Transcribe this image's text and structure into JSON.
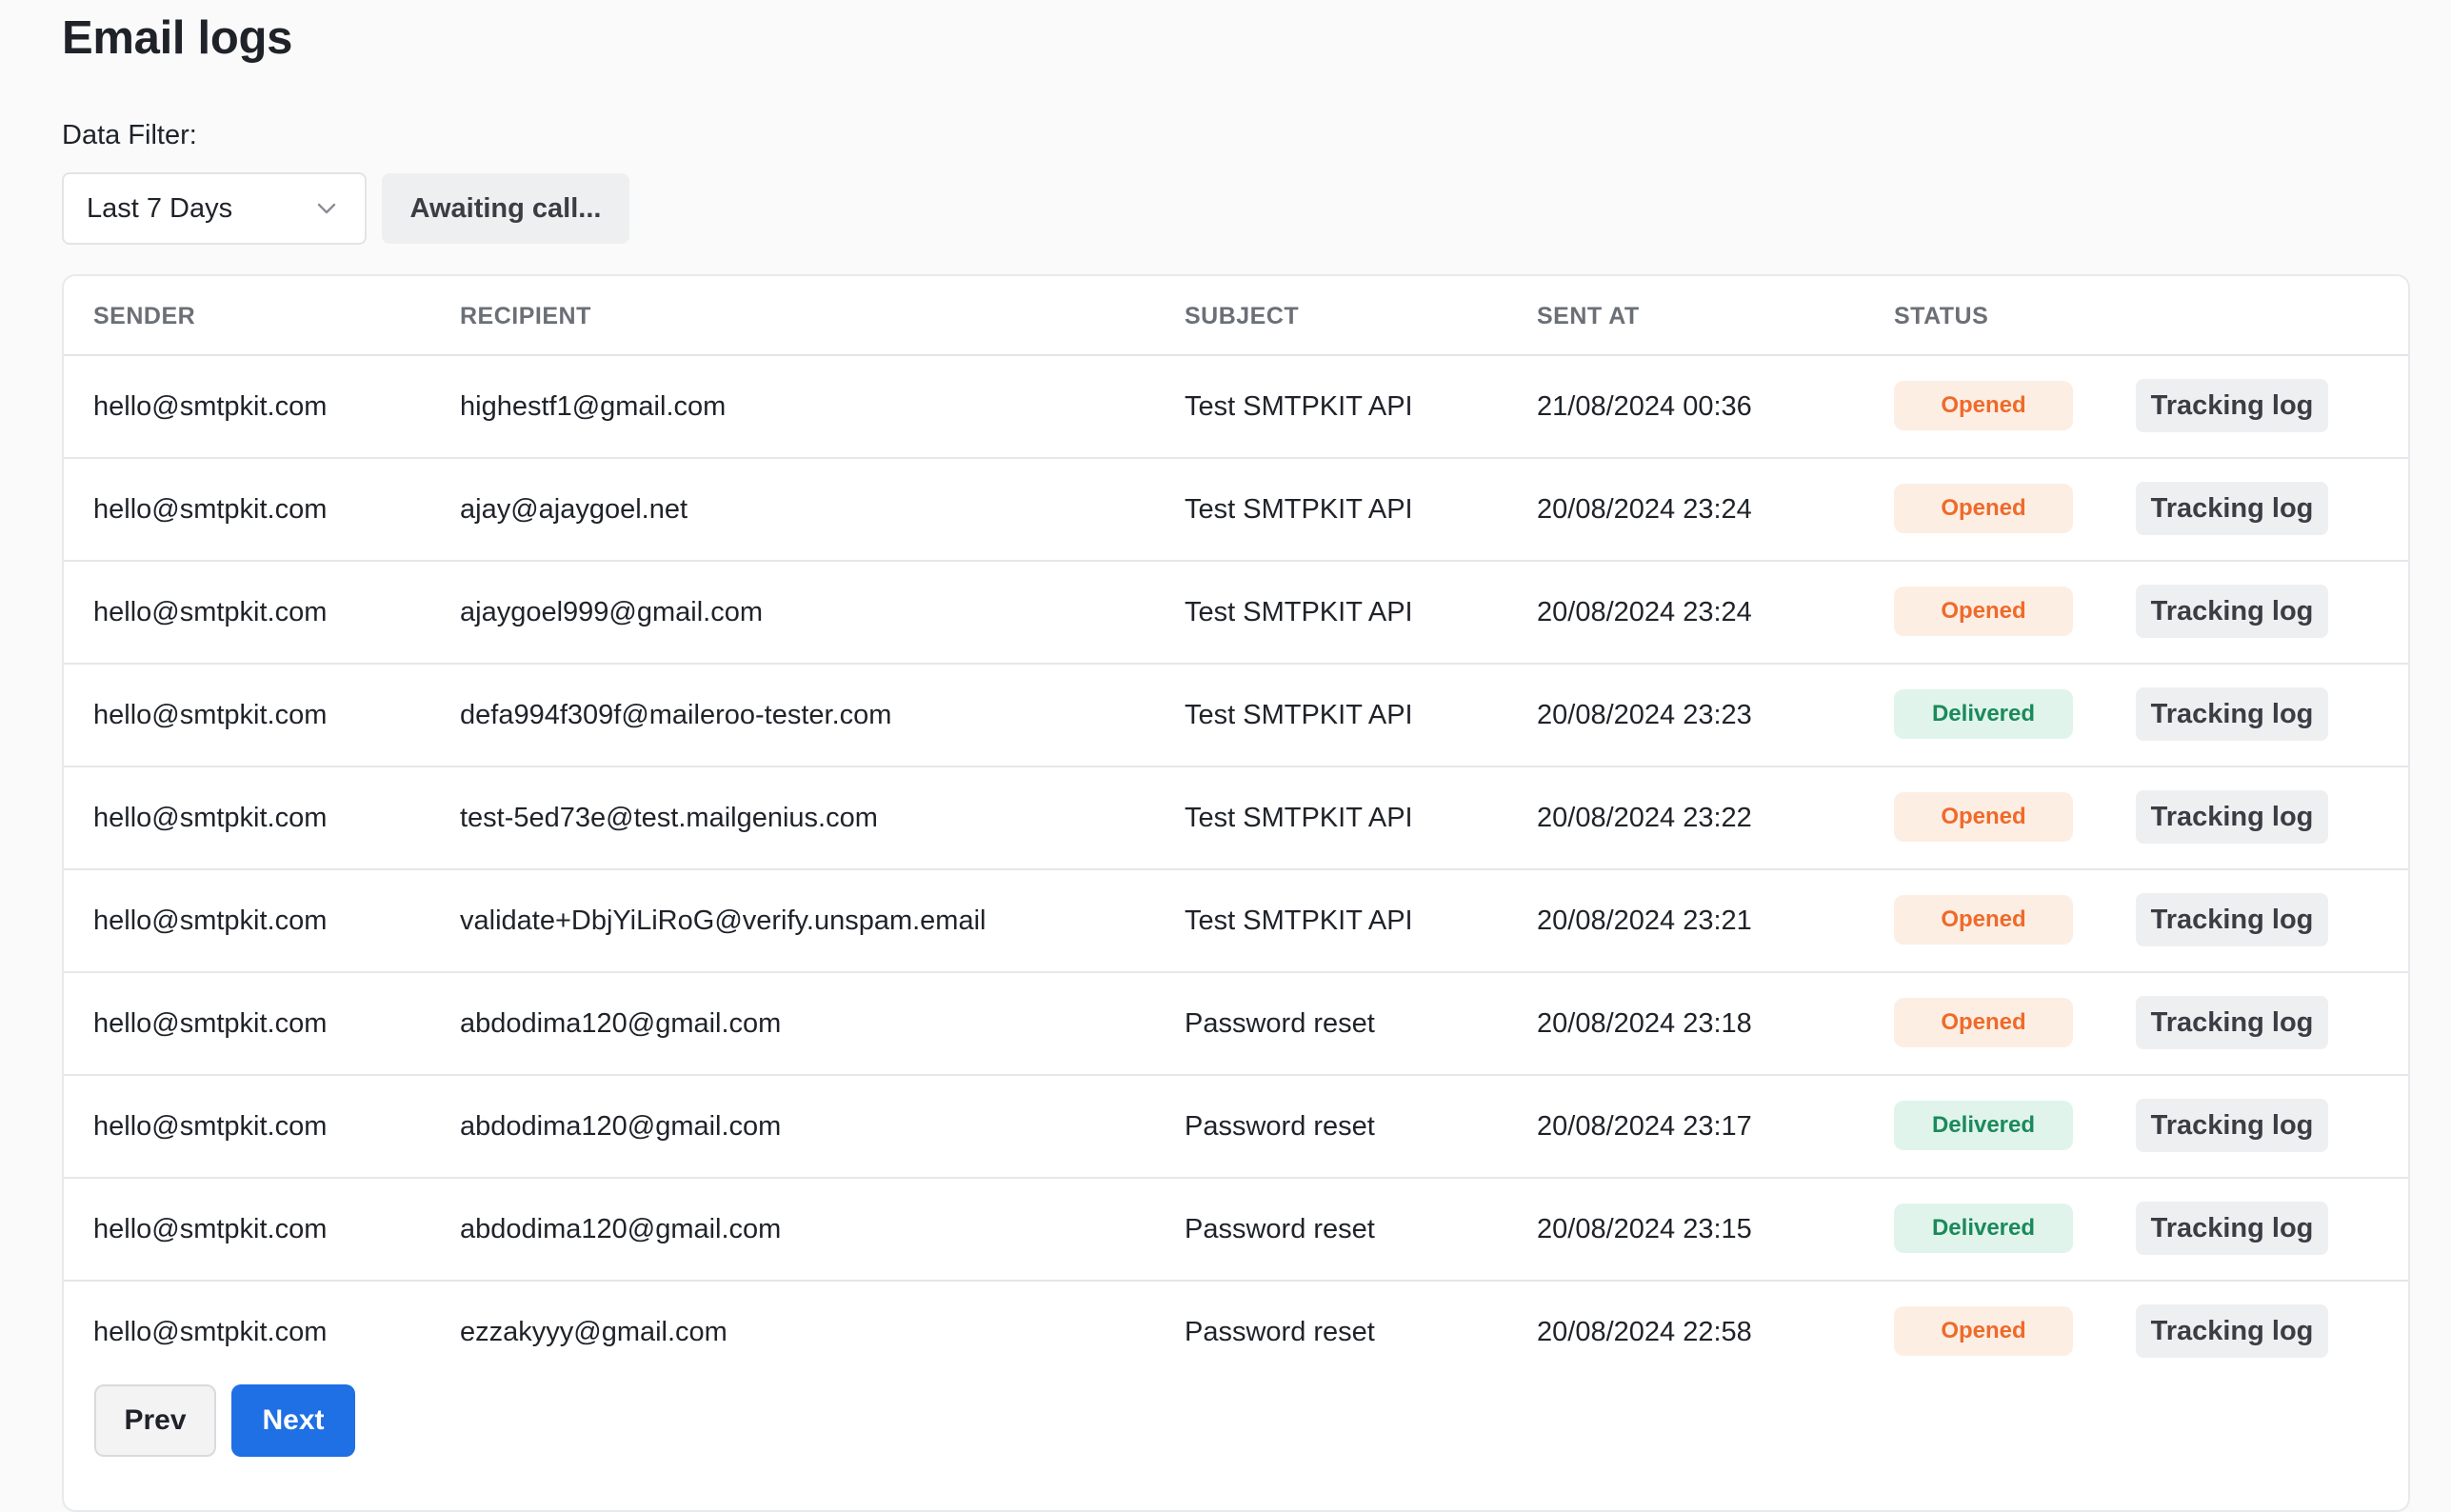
{
  "page": {
    "title": "Email logs"
  },
  "filter": {
    "label": "Data Filter:",
    "selected": "Last 7 Days",
    "awaiting_label": "Awaiting call..."
  },
  "table": {
    "headers": {
      "sender": "SENDER",
      "recipient": "RECIPIENT",
      "subject": "SUBJECT",
      "sent_at": "SENT AT",
      "status": "STATUS"
    },
    "action_label": "Tracking log",
    "rows": [
      {
        "sender": "hello@smtpkit.com",
        "recipient": "highestf1@gmail.com",
        "subject": "Test SMTPKIT API",
        "sent_at": "21/08/2024 00:36",
        "status": "Opened"
      },
      {
        "sender": "hello@smtpkit.com",
        "recipient": "ajay@ajaygoel.net",
        "subject": "Test SMTPKIT API",
        "sent_at": "20/08/2024 23:24",
        "status": "Opened"
      },
      {
        "sender": "hello@smtpkit.com",
        "recipient": "ajaygoel999@gmail.com",
        "subject": "Test SMTPKIT API",
        "sent_at": "20/08/2024 23:24",
        "status": "Opened"
      },
      {
        "sender": "hello@smtpkit.com",
        "recipient": "defa994f309f@maileroo-tester.com",
        "subject": "Test SMTPKIT API",
        "sent_at": "20/08/2024 23:23",
        "status": "Delivered"
      },
      {
        "sender": "hello@smtpkit.com",
        "recipient": "test-5ed73e@test.mailgenius.com",
        "subject": "Test SMTPKIT API",
        "sent_at": "20/08/2024 23:22",
        "status": "Opened"
      },
      {
        "sender": "hello@smtpkit.com",
        "recipient": "validate+DbjYiLiRoG@verify.unspam.email",
        "subject": "Test SMTPKIT API",
        "sent_at": "20/08/2024 23:21",
        "status": "Opened"
      },
      {
        "sender": "hello@smtpkit.com",
        "recipient": "abdodima120@gmail.com",
        "subject": "Password reset",
        "sent_at": "20/08/2024 23:18",
        "status": "Opened"
      },
      {
        "sender": "hello@smtpkit.com",
        "recipient": "abdodima120@gmail.com",
        "subject": "Password reset",
        "sent_at": "20/08/2024 23:17",
        "status": "Delivered"
      },
      {
        "sender": "hello@smtpkit.com",
        "recipient": "abdodima120@gmail.com",
        "subject": "Password reset",
        "sent_at": "20/08/2024 23:15",
        "status": "Delivered"
      },
      {
        "sender": "hello@smtpkit.com",
        "recipient": "ezzakyyy@gmail.com",
        "subject": "Password reset",
        "sent_at": "20/08/2024 22:58",
        "status": "Opened"
      }
    ]
  },
  "pagination": {
    "prev_label": "Prev",
    "next_label": "Next"
  },
  "colors": {
    "opened_bg": "#fdeee3",
    "opened_text": "#ef6a2a",
    "delivered_bg": "#e0f4ec",
    "delivered_text": "#1b8a5a",
    "primary": "#1f6fe5"
  },
  "icons": {
    "select_chevron": "chevron-down-icon"
  }
}
